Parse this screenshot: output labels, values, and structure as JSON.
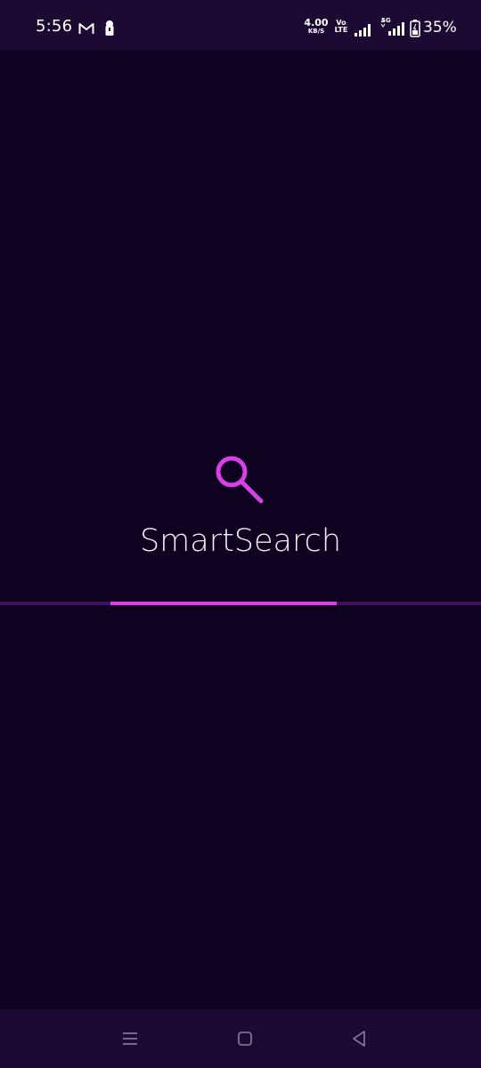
{
  "status_bar": {
    "time": "5:56",
    "net_speed_value": "4.00",
    "net_speed_unit": "KB/S",
    "volte_top": "Vo",
    "volte_bottom": "LTE",
    "network_5g": "5G",
    "battery_percent": "35%",
    "notification_icons": [
      "gmail-icon",
      "lock-icon"
    ],
    "status_icons": [
      "signal-icon",
      "signal-5g-icon",
      "battery-icon"
    ]
  },
  "splash": {
    "app_name": "SmartSearch",
    "logo_icon": "search-icon",
    "accent_color": "#d640e4"
  },
  "loading": {
    "progress_fraction": 0.47,
    "start_fraction": 0.23
  },
  "navigation": {
    "icons": [
      "menu-icon",
      "home-icon",
      "back-icon"
    ]
  },
  "colors": {
    "background": "#0f0220",
    "bars": "#1c0a33",
    "track": "#3d1159",
    "accent": "#d640e4"
  }
}
